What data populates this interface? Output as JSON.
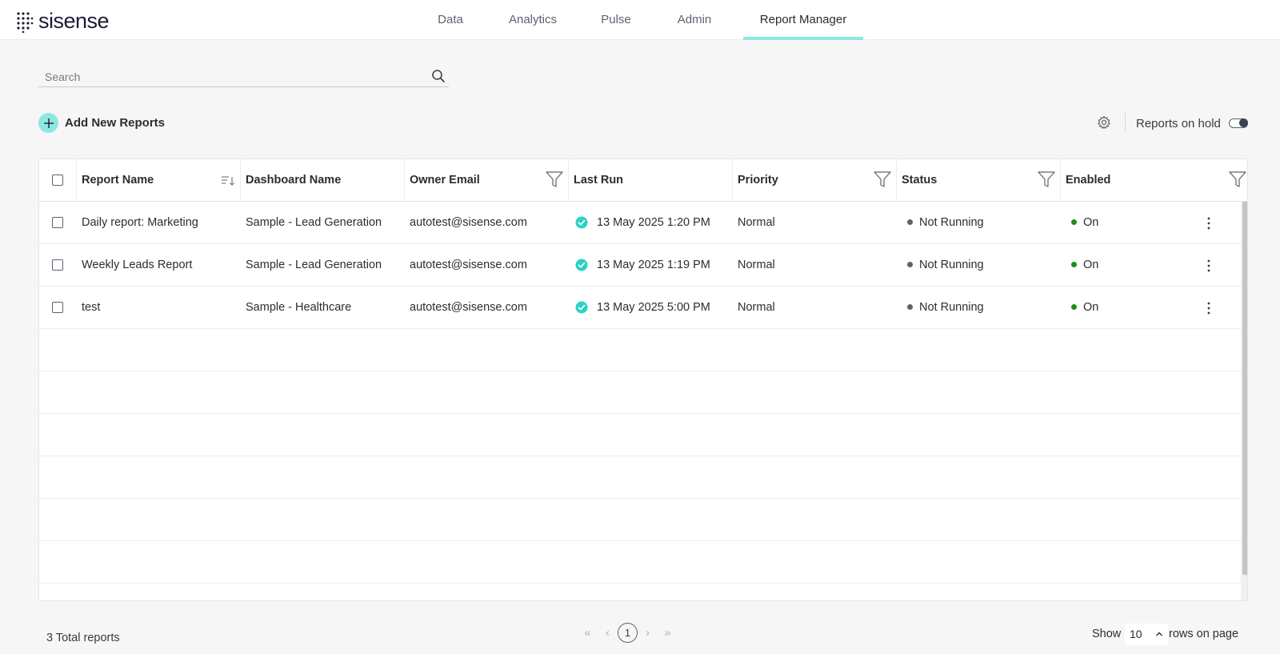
{
  "app": {
    "logo_text": "sisense"
  },
  "nav": [
    {
      "label": "Data"
    },
    {
      "label": "Analytics"
    },
    {
      "label": "Pulse"
    },
    {
      "label": "Admin"
    },
    {
      "label": "Report Manager",
      "active": true
    }
  ],
  "search": {
    "placeholder": "Search",
    "value": ""
  },
  "toolbar": {
    "add_label": "Add New Reports",
    "onhold_label": "Reports on hold",
    "onhold_enabled": false
  },
  "table": {
    "columns": [
      {
        "label": "Report Name",
        "icon": "sort-icon"
      },
      {
        "label": "Dashboard Name"
      },
      {
        "label": "Owner Email",
        "icon": "filter-icon"
      },
      {
        "label": "Last Run"
      },
      {
        "label": "Priority",
        "icon": "filter-icon"
      },
      {
        "label": "Status",
        "icon": "filter-icon"
      },
      {
        "label": "Enabled",
        "icon": "filter-icon"
      }
    ],
    "rows": [
      {
        "report": "Daily report: Marketing",
        "dashboard": "Sample - Lead Generation",
        "owner": "autotest@sisense.com",
        "last_run": "13 May 2025 1:20 PM",
        "priority": "Normal",
        "status": "Not Running",
        "enabled": "On"
      },
      {
        "report": "Weekly Leads Report",
        "dashboard": "Sample - Lead Generation",
        "owner": "autotest@sisense.com",
        "last_run": "13 May 2025 1:19 PM",
        "priority": "Normal",
        "status": "Not Running",
        "enabled": "On"
      },
      {
        "report": "test",
        "dashboard": "Sample - Healthcare",
        "owner": "autotest@sisense.com",
        "last_run": "13 May 2025 5:00 PM",
        "priority": "Normal",
        "status": "Not Running",
        "enabled": "On"
      }
    ]
  },
  "footer": {
    "total": "3 Total reports",
    "current_page": "1",
    "show_label": "Show",
    "rows_value": "10",
    "rows_label": "rows on page"
  },
  "colors": {
    "accent": "#8ce8e0",
    "success": "#2ed1c4",
    "status_idle": "#5b6372",
    "enabled_on": "#1a8f1a"
  }
}
